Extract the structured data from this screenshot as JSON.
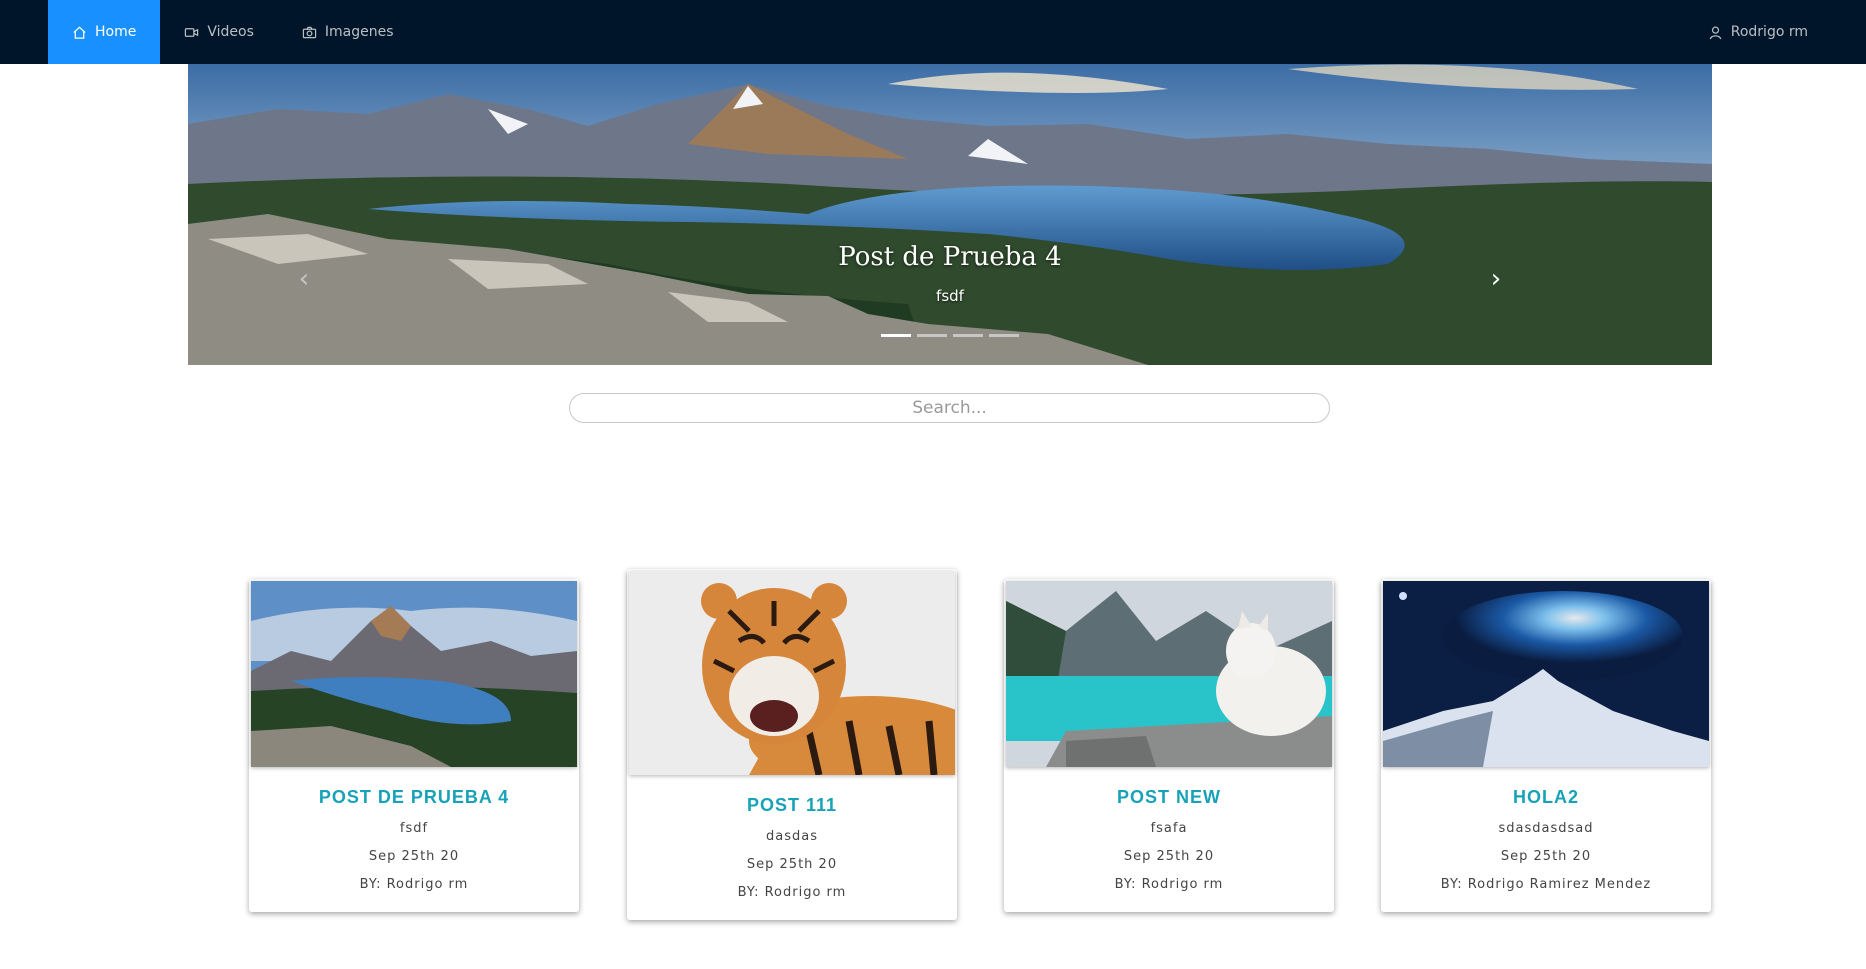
{
  "nav": {
    "items": [
      {
        "label": "Home",
        "icon": "home-icon",
        "active": true
      },
      {
        "label": "Videos",
        "icon": "video-camera-icon",
        "active": false
      },
      {
        "label": "Imagenes",
        "icon": "camera-icon",
        "active": false
      }
    ],
    "user": {
      "label": "Rodrigo rm",
      "icon": "user-icon"
    }
  },
  "carousel": {
    "title": "Post de Prueba 4",
    "subtitle": "fsdf",
    "slide_count": 4,
    "active_index": 0,
    "prev_label": "‹",
    "next_label": "›"
  },
  "search": {
    "placeholder": "Search..."
  },
  "posts": [
    {
      "title": "POST DE PRUEBA 4",
      "description": "fsdf",
      "date": "Sep 25th 20",
      "author": "BY: Rodrigo rm",
      "image": "mountain-lake"
    },
    {
      "title": "POST 111",
      "description": "dasdas",
      "date": "Sep 25th 20",
      "author": "BY: Rodrigo rm",
      "image": "tiger"
    },
    {
      "title": "POST NEW",
      "description": "fsafa",
      "date": "Sep 25th 20",
      "author": "BY: Rodrigo rm",
      "image": "lake-wolf"
    },
    {
      "title": "HOLA2",
      "description": "sdasdasdsad",
      "date": "Sep 25th 20",
      "author": "BY: Rodrigo Ramirez Mendez",
      "image": "galaxy"
    }
  ],
  "colors": {
    "nav_bg": "#001529",
    "nav_active": "#1890ff",
    "card_title": "#17a2b8"
  }
}
